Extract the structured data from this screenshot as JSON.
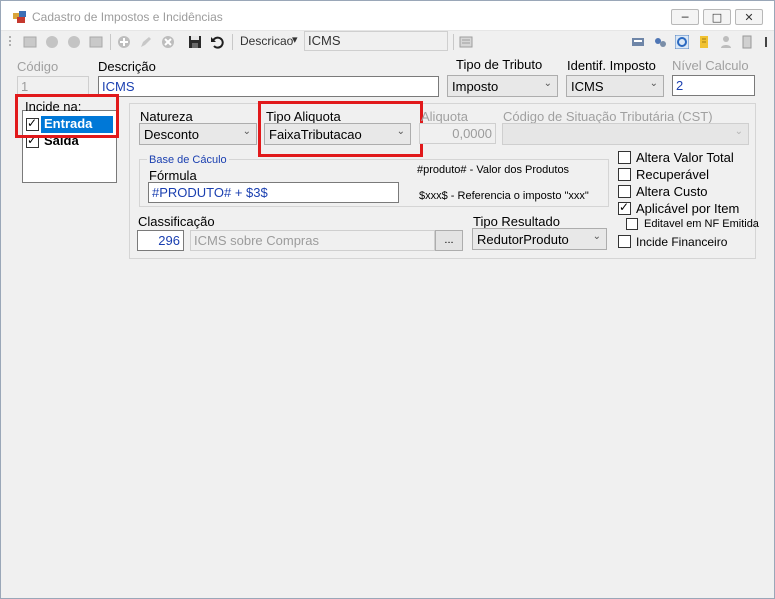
{
  "window": {
    "title": "Cadastro de Impostos e Incidências",
    "minimize": "─",
    "maximize": "□",
    "close": "✕"
  },
  "toolbar": {
    "descricao_label": "Descricao",
    "dropdown_arrow": "▾",
    "search_value": "ICMS"
  },
  "fields": {
    "codigo_label": "Código",
    "codigo_value": "1",
    "descricao_label": "Descrição",
    "descricao_value": "ICMS",
    "tipo_tributo_label": "Tipo de Tributo",
    "tipo_tributo_value": "Imposto",
    "identif_imposto_label": "Identif. Imposto",
    "identif_imposto_value": "ICMS",
    "nivel_calculo_label": "Nível Calculo",
    "nivel_calculo_value": "2"
  },
  "incide": {
    "label": "Incide na:",
    "items": [
      {
        "label": "Entrada",
        "checked": true,
        "selected": true
      },
      {
        "label": "Saída",
        "checked": true,
        "selected": false
      }
    ]
  },
  "natureza": {
    "label": "Natureza",
    "value": "Desconto"
  },
  "tipo_aliquota": {
    "label": "Tipo Aliquota",
    "value": "FaixaTributacao"
  },
  "aliquota": {
    "label": "Aliquota",
    "value": "0,0000"
  },
  "cst": {
    "label": "Código de Situação Tributária (CST)",
    "value": ""
  },
  "base_calculo": {
    "group_label": "Base de Cáculo",
    "formula_label": "Fórmula",
    "formula_value": "#PRODUTO# + $3$",
    "hint1": "#produto# - Valor dos Produtos",
    "hint2": "$xxx$ - Referencia o imposto \"xxx\""
  },
  "classificacao": {
    "label": "Classificação",
    "code": "296",
    "description": "ICMS sobre Compras",
    "browse_label": "..."
  },
  "tipo_resultado": {
    "label": "Tipo Resultado",
    "value": "RedutorProduto"
  },
  "options": {
    "altera_valor_total": {
      "label": "Altera Valor Total",
      "checked": false
    },
    "recuperavel": {
      "label": "Recuperável",
      "checked": false
    },
    "altera_custo": {
      "label": "Altera Custo",
      "checked": false
    },
    "aplicavel_por_item": {
      "label": "Aplicável por Item",
      "checked": true
    },
    "editavel_nf_emitida": {
      "label": "Editavel em NF Emitida",
      "checked": false
    },
    "incide_financeiro": {
      "label": "Incide Financeiro",
      "checked": false
    }
  },
  "colors": {
    "highlight_red": "#e1191b",
    "selection_blue": "#0078d7",
    "group_label_blue": "#1a3fb0"
  }
}
